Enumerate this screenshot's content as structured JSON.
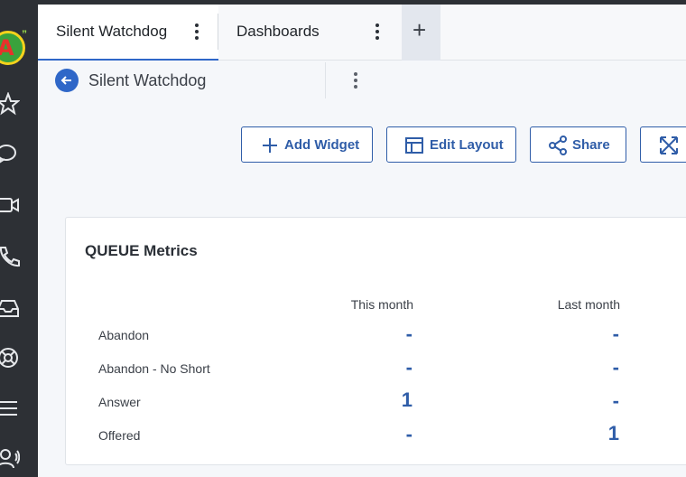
{
  "tabs": [
    {
      "label": "Silent Watchdog",
      "active": true
    },
    {
      "label": "Dashboards",
      "active": false
    }
  ],
  "add_tab_symbol": "+",
  "breadcrumb": {
    "title": "Silent Watchdog"
  },
  "toolbar": {
    "add_widget": "Add Widget",
    "edit_layout": "Edit Layout",
    "share": "Share"
  },
  "card": {
    "title": "QUEUE Metrics",
    "columns": [
      "This month",
      "Last month"
    ],
    "rows": [
      {
        "label": "Abandon",
        "this_month": "-",
        "last_month": "-"
      },
      {
        "label": "Abandon - No Short",
        "this_month": "-",
        "last_month": "-"
      },
      {
        "label": "Answer",
        "this_month": "1",
        "last_month": "-"
      },
      {
        "label": "Offered",
        "this_month": "-",
        "last_month": "1"
      }
    ]
  },
  "colors": {
    "accent": "#2f67c8",
    "button_text": "#2f5da8",
    "rail": "#2d3035"
  },
  "rail_icons": [
    "app-logo-icon",
    "star-icon",
    "chat-icon",
    "video-icon",
    "phone-icon",
    "inbox-icon",
    "support-icon",
    "menu-icon",
    "agent-icon"
  ]
}
